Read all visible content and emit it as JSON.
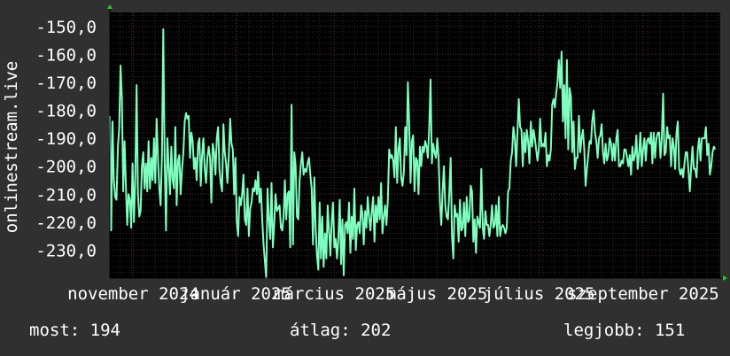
{
  "colors": {
    "background": "#303030",
    "plot_background": "#000000",
    "line": "#7fffbf",
    "grid_minor": "#2a2a2a",
    "grid_major": "#5a2a2a",
    "text": "#ffffff",
    "arrow": "#22cc22"
  },
  "stats": {
    "now_label": "most:",
    "now_value": "194",
    "avg_label": "átlag:",
    "avg_value": "202",
    "best_label": "legjobb:",
    "best_value": "151"
  },
  "chart_data": {
    "type": "line",
    "ylabel": "onlinestream.live",
    "ylim": [
      -240,
      -145
    ],
    "yticks": [
      -150,
      -160,
      -170,
      -180,
      -190,
      -200,
      -210,
      -220,
      -230
    ],
    "ytick_labels": [
      "-150,0",
      "-160,0",
      "-170,0",
      "-180,0",
      "-190,0",
      "-200,0",
      "-210,0",
      "-220,0",
      "-230,0"
    ],
    "xlim": [
      "2024-10-18",
      "2025-10-17"
    ],
    "xticks": [
      "2024-11-01",
      "2025-01-01",
      "2025-03-01",
      "2025-05-01",
      "2025-07-01",
      "2025-09-01"
    ],
    "xtick_labels": [
      "november 2024",
      "január 2025",
      "március 2025",
      "május 2025",
      "július 2025",
      "szeptember 2025"
    ],
    "grid": true,
    "series": [
      {
        "x_start": "2024-10-18",
        "x_end": "2025-10-14",
        "values": [
          -182,
          -223,
          -184,
          -205,
          -211,
          -212,
          -193,
          -186,
          -164,
          -176,
          -209,
          -191,
          -207,
          -221,
          -210,
          -212,
          -222,
          -199,
          -220,
          -204,
          -171,
          -210,
          -218,
          -216,
          -200,
          -195,
          -208,
          -199,
          -209,
          -191,
          -208,
          -197,
          -205,
          -190,
          -206,
          -183,
          -197,
          -208,
          -214,
          -196,
          -151,
          -197,
          -223,
          -190,
          -200,
          -210,
          -193,
          -205,
          -208,
          -186,
          -214,
          -198,
          -196,
          -210,
          -201,
          -195,
          -184,
          -181,
          -183,
          -182,
          -197,
          -188,
          -191,
          -201,
          -197,
          -205,
          -192,
          -190,
          -207,
          -196,
          -190,
          -201,
          -206,
          -197,
          -193,
          -197,
          -213,
          -192,
          -195,
          -203,
          -190,
          -186,
          -201,
          -206,
          -209,
          -185,
          -195,
          -199,
          -206,
          -196,
          -183,
          -192,
          -194,
          -210,
          -197,
          -220,
          -225,
          -211,
          -214,
          -210,
          -203,
          -219,
          -221,
          -208,
          -225,
          -215,
          -213,
          -208,
          -209,
          -205,
          -210,
          -202,
          -213,
          -208,
          -219,
          -228,
          -234,
          -240,
          -208,
          -219,
          -226,
          -206,
          -229,
          -221,
          -210,
          -216,
          -215,
          -214,
          -222,
          -223,
          -218,
          -205,
          -219,
          -210,
          -209,
          -229,
          -178,
          -228,
          -195,
          -200,
          -218,
          -219,
          -205,
          -199,
          -195,
          -203,
          -201,
          -202,
          -199,
          -197,
          -203,
          -208,
          -228,
          -204,
          -222,
          -232,
          -237,
          -213,
          -233,
          -218,
          -236,
          -224,
          -233,
          -214,
          -223,
          -232,
          -220,
          -213,
          -229,
          -226,
          -233,
          -226,
          -212,
          -235,
          -219,
          -239,
          -221,
          -220,
          -224,
          -213,
          -231,
          -218,
          -226,
          -208,
          -230,
          -221,
          -220,
          -224,
          -214,
          -217,
          -228,
          -216,
          -222,
          -211,
          -218,
          -223,
          -216,
          -211,
          -227,
          -214,
          -220,
          -211,
          -219,
          -206,
          -224,
          -218,
          -214,
          -221,
          -212,
          -194,
          -197,
          -196,
          -198,
          -204,
          -186,
          -206,
          -194,
          -190,
          -204,
          -207,
          -202,
          -186,
          -196,
          -170,
          -185,
          -206,
          -191,
          -189,
          -209,
          -197,
          -198,
          -210,
          -193,
          -200,
          -193,
          -195,
          -191,
          -193,
          -197,
          -186,
          -169,
          -199,
          -192,
          -195,
          -197,
          -190,
          -197,
          -213,
          -221,
          -209,
          -200,
          -214,
          -218,
          -219,
          -210,
          -197,
          -225,
          -233,
          -214,
          -218,
          -217,
          -227,
          -212,
          -223,
          -222,
          -213,
          -225,
          -211,
          -220,
          -219,
          -207,
          -209,
          -227,
          -219,
          -231,
          -218,
          -220,
          -222,
          -201,
          -222,
          -226,
          -216,
          -221,
          -221,
          -225,
          -221,
          -214,
          -222,
          -221,
          -214,
          -225,
          -211,
          -225,
          -222,
          -221,
          -222,
          -224,
          -222,
          -209,
          -208,
          -198,
          -195,
          -186,
          -190,
          -200,
          -188,
          -176,
          -186,
          -187,
          -200,
          -188,
          -195,
          -187,
          -191,
          -199,
          -184,
          -193,
          -187,
          -190,
          -194,
          -198,
          -194,
          -183,
          -193,
          -192,
          -193,
          -188,
          -200,
          -196,
          -198,
          -194,
          -178,
          -176,
          -179,
          -174,
          -170,
          -162,
          -172,
          -159,
          -184,
          -171,
          -190,
          -162,
          -194,
          -172,
          -175,
          -195,
          -184,
          -201,
          -197,
          -197,
          -182,
          -195,
          -190,
          -187,
          -194,
          -207,
          -201,
          -196,
          -191,
          -192,
          -184,
          -180,
          -188,
          -191,
          -197,
          -190,
          -189,
          -185,
          -195,
          -199,
          -192,
          -198,
          -196,
          -190,
          -192,
          -198,
          -192,
          -198,
          -190,
          -187,
          -200,
          -200,
          -198,
          -199,
          -194,
          -194,
          -197,
          -200,
          -196,
          -203,
          -193,
          -198,
          -196,
          -189,
          -201,
          -196,
          -188,
          -200,
          -194,
          -190,
          -198,
          -191,
          -190,
          -192,
          -188,
          -199,
          -188,
          -197,
          -190,
          -188,
          -188,
          -197,
          -190,
          -174,
          -196,
          -195,
          -186,
          -190,
          -189,
          -200,
          -190,
          -193,
          -201,
          -188,
          -184,
          -201,
          -203,
          -201,
          -204,
          -199,
          -195,
          -195,
          -202,
          -209,
          -200,
          -193,
          -201,
          -201,
          -204,
          -194,
          -190,
          -198,
          -190,
          -190,
          -190,
          -186,
          -196,
          -192,
          -203,
          -200,
          -195,
          -193,
          -194
        ]
      }
    ]
  }
}
